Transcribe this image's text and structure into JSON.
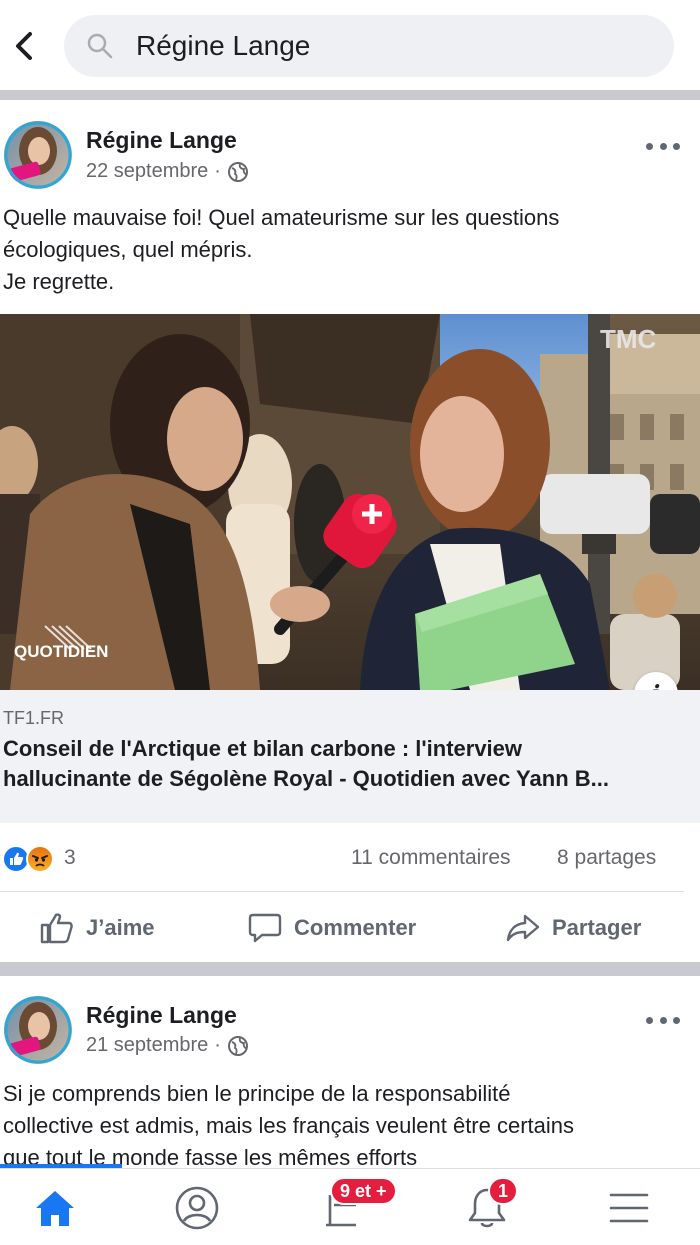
{
  "search": {
    "query": "Régine Lange"
  },
  "posts": [
    {
      "author": "Régine Lange",
      "date": "22 septembre",
      "separator": "·",
      "text_lines": [
        "Quelle mauvaise foi! Quel amateurisme sur les questions",
        "écologiques, quel mépris.",
        "Je regrette."
      ],
      "link": {
        "domain": "TF1.FR",
        "title_line1": "Conseil de l'Arctique et bilan carbone : l'interview",
        "title_line2": "hallucinante de Ségolène Royal - Quotidien avec Yann B...",
        "image_watermark": "QUOTIDIEN",
        "channel_logo": "TMC",
        "info_badge": "i"
      },
      "reactions": {
        "count": "3",
        "comments": "11 commentaires",
        "shares": "8 partages",
        "icons": [
          "like-icon",
          "angry-icon"
        ]
      },
      "actions": {
        "like": "J’aime",
        "comment": "Commenter",
        "share": "Partager"
      }
    },
    {
      "author": "Régine Lange",
      "date": "21 septembre",
      "separator": "·",
      "text_lines": [
        "Si je comprends bien le principe de la responsabilité",
        "collective est admis, mais les français veulent être certains",
        "que tout le monde fasse les mêmes efforts"
      ]
    }
  ],
  "bottom_nav": {
    "items": [
      "home-icon",
      "profile-icon",
      "groups-icon",
      "notifications-icon",
      "menu-icon"
    ],
    "groups_badge": "9 et +",
    "notifications_badge": "1"
  },
  "colors": {
    "accent": "#1877f2",
    "badge": "#e41e3f",
    "separator": "#c8cacf",
    "link_info_bg": "#f0f2f5"
  }
}
